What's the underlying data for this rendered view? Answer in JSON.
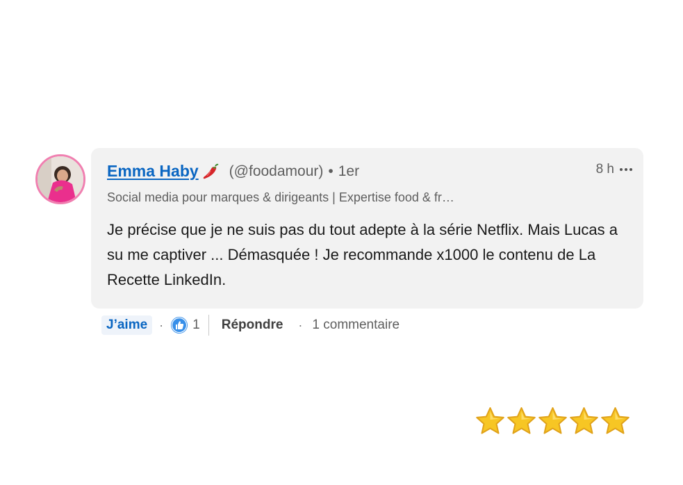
{
  "comment": {
    "author_name": "Emma Haby",
    "author_emoji": "chili-pepper-icon",
    "handle": "(@foodamour)",
    "separator": "•",
    "degree": "1er",
    "time": "8 h",
    "headline": "Social media pour marques & dirigeants | Expertise food & fr…",
    "text": "Je précise que je ne suis pas du tout adepte à la série Netflix. Mais Lucas a su me captiver ... Démasquée ! Je recommande x1000 le contenu de La Recette LinkedIn."
  },
  "actions": {
    "like_label": "J’aime",
    "dot": "·",
    "reaction_icon": "thumbs-up-icon",
    "reaction_count": "1",
    "reply_label": "Répondre",
    "replies_label": "1 commentaire"
  },
  "rating": {
    "stars": 5,
    "max": 5,
    "icon": "star-icon"
  },
  "colors": {
    "link_blue": "#0a66c2",
    "bubble_bg": "#f2f2f2",
    "avatar_border": "#f07fb0",
    "star_gold": "#f7c624"
  }
}
